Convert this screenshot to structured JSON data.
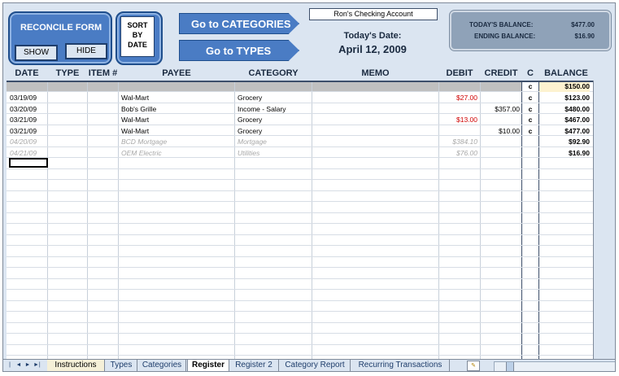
{
  "reconcile": {
    "title": "RECONCILE FORM",
    "show_label": "SHOW",
    "hide_label": "HIDE"
  },
  "sort": {
    "label_line1": "SORT",
    "label_line2": "BY",
    "label_line3": "DATE"
  },
  "nav": {
    "categories_label": "Go to CATEGORIES",
    "types_label": "Go to TYPES"
  },
  "account": {
    "name": "Ron's Checking Account",
    "todays_date_label": "Today's Date:",
    "todays_date_value": "April 12, 2009"
  },
  "balance": {
    "todays_label": "TODAY'S BALANCE:",
    "todays_value": "$477.00",
    "ending_label": "ENDING BALANCE:",
    "ending_value": "$16.90"
  },
  "columns": [
    "DATE",
    "TYPE",
    "ITEM #",
    "PAYEE",
    "CATEGORY",
    "MEMO",
    "DEBIT",
    "CREDIT",
    "C",
    "BALANCE"
  ],
  "opening": {
    "c": "c",
    "balance": "$150.00"
  },
  "rows": [
    {
      "date": "03/19/09",
      "payee": "Wal-Mart",
      "category": "Grocery",
      "memo": "",
      "debit": "$27.00",
      "credit": "",
      "c": "c",
      "balance": "$123.00"
    },
    {
      "date": "03/20/09",
      "payee": "Bob's Grille",
      "category": "Income - Salary",
      "memo": "",
      "debit": "",
      "credit": "$357.00",
      "c": "c",
      "balance": "$480.00"
    },
    {
      "date": "03/21/09",
      "payee": "Wal-Mart",
      "category": "Grocery",
      "memo": "",
      "debit": "$13.00",
      "credit": "",
      "c": "c",
      "balance": "$467.00"
    },
    {
      "date": "03/21/09",
      "payee": "Wal-Mart",
      "category": "Grocery",
      "memo": "",
      "debit": "",
      "credit": "$10.00",
      "c": "c",
      "balance": "$477.00"
    },
    {
      "date": "04/20/09",
      "payee": "BCD Mortgage",
      "category": "Mortgage",
      "memo": "",
      "debit": "$384.10",
      "credit": "",
      "c": "",
      "balance": "$92.90"
    },
    {
      "date": "04/21/09",
      "payee": "OEM Electric",
      "category": "Utilities",
      "memo": "",
      "debit": "$76.00",
      "credit": "",
      "c": "",
      "balance": "$16.90"
    }
  ],
  "tabs": [
    "Instructions",
    "Types",
    "Categories",
    "Register",
    "Register 2",
    "Category Report",
    "Recurring Transactions"
  ],
  "active_tab": "Register",
  "colors": {
    "accent": "#4a7cc4",
    "debit_red": "#d00000",
    "future_gray": "#a8a8a8"
  },
  "icons": {
    "nav_first": "first-sheet-icon",
    "nav_prev": "prev-sheet-icon",
    "nav_next": "next-sheet-icon",
    "nav_last": "last-sheet-icon",
    "insert_sheet": "insert-sheet-icon"
  }
}
